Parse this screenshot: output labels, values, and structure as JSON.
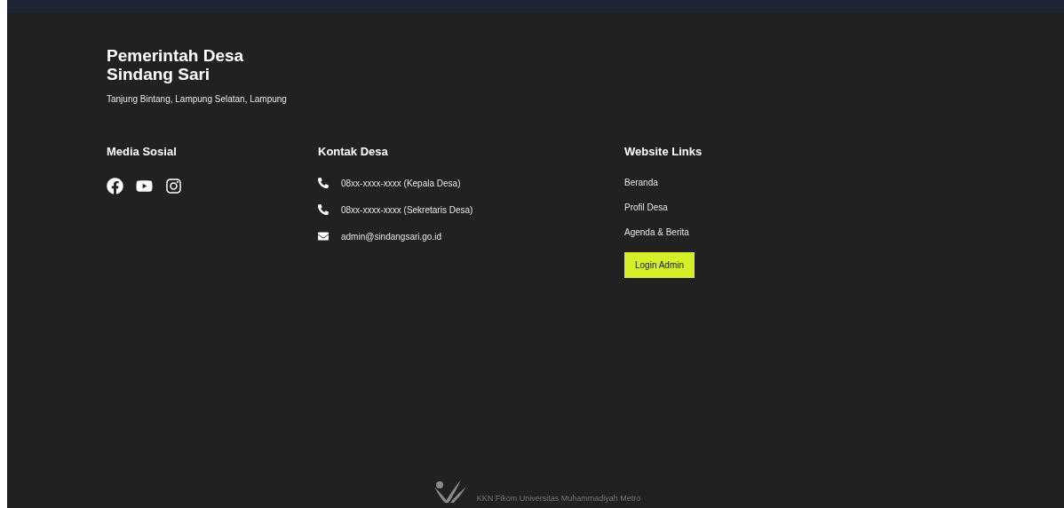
{
  "brand": {
    "title_line1": "Pemerintah Desa",
    "title_line2": "Sindang Sari",
    "address": "Tanjung Bintang, Lampung Selatan, Lampung"
  },
  "social": {
    "heading": "Media Sosial",
    "links": [
      {
        "kind": "facebook"
      },
      {
        "kind": "youtube"
      },
      {
        "kind": "instagram"
      }
    ]
  },
  "contact": {
    "heading": "Kontak Desa",
    "items": [
      {
        "kind": "phone",
        "text": "08xx-xxxx-xxxx (Kepala Desa)"
      },
      {
        "kind": "phone",
        "text": "08xx-xxxx-xxxx (Sekretaris Desa)"
      },
      {
        "kind": "email",
        "text": "admin@sindangsari.go.id"
      }
    ]
  },
  "links": {
    "heading": "Website Links",
    "items": [
      "Beranda",
      "Profil Desa",
      "Agenda & Berita"
    ],
    "button": "Login Admin"
  },
  "credit": "KKN Fikom Universitas Muhammadiyah Metro"
}
